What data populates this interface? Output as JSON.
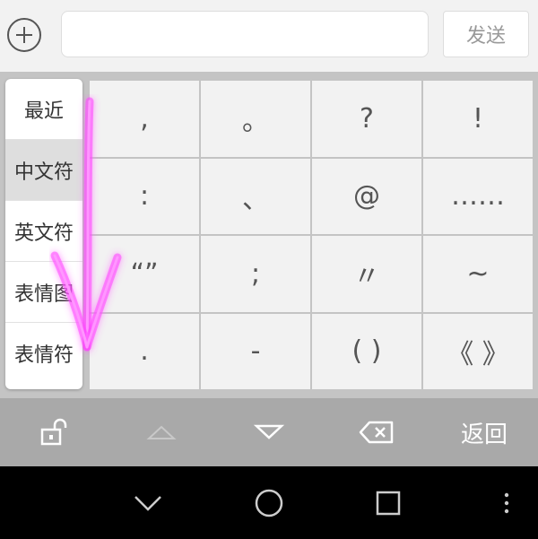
{
  "top_bar": {
    "plus_icon": "plus-circle-icon",
    "message_input": {
      "value": "",
      "placeholder": ""
    },
    "send_label": "发送"
  },
  "categories": [
    {
      "label": "最近",
      "active": false
    },
    {
      "label": "中文符",
      "active": true
    },
    {
      "label": "英文符",
      "active": false
    },
    {
      "label": "表情图",
      "active": false
    },
    {
      "label": "表情符",
      "active": false
    }
  ],
  "symbols": [
    ",",
    "。",
    "?",
    "!",
    ":",
    "、",
    "@",
    "……",
    "“”",
    ";",
    "〃",
    "~",
    ".",
    "-",
    "( )",
    "《 》"
  ],
  "function_bar": {
    "lock_icon": "unlock-icon",
    "up_icon": "triangle-up-icon",
    "down_icon": "triangle-down-icon",
    "backspace_icon": "backspace-icon",
    "return_label": "返回"
  },
  "nav_bar": {
    "icons": [
      "chevron-down-icon",
      "home-circle-icon",
      "square-recents-icon",
      "more-vertical-icon"
    ]
  },
  "colors": {
    "arrow_glow": "#ff40ff",
    "function_bar": "#a9a9a9",
    "keyboard_bg": "#c4c4c4"
  }
}
